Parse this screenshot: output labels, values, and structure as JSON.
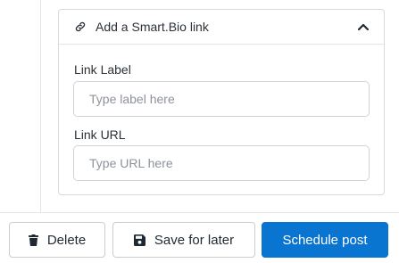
{
  "card": {
    "title": "Add a Smart.Bio link",
    "icon": "link-icon",
    "toggle_icon": "chevron-up-icon"
  },
  "fields": {
    "label": {
      "label": "Link Label",
      "placeholder": "Type label here",
      "value": ""
    },
    "url": {
      "label": "Link URL",
      "placeholder": "Type URL here",
      "value": ""
    }
  },
  "footer": {
    "delete_label": "Delete",
    "delete_icon": "trash-icon",
    "save_label": "Save for later",
    "save_icon": "floppy-disk-icon",
    "schedule_label": "Schedule post"
  },
  "colors": {
    "primary": "#0a74d1",
    "border": "#d6d9de",
    "placeholder": "#8c939b"
  }
}
